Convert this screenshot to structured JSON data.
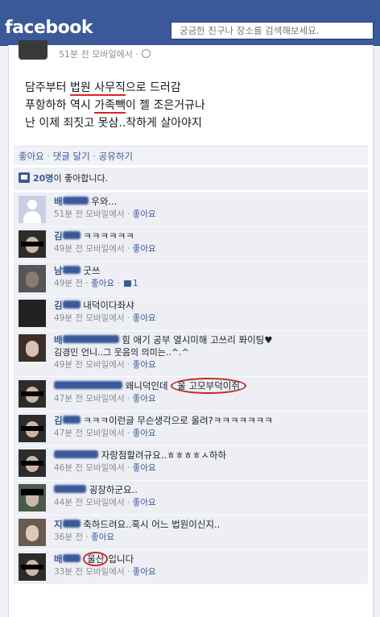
{
  "header": {
    "logo": "facebook",
    "search_placeholder": "궁금한 친구나 장소를 검색해보세요."
  },
  "post": {
    "meta": "51분 전 모바일에서 ·",
    "lines": [
      "담주부터 법원 사무직으로 드러감",
      "푸항하하 역시 가족빽이 젤 조은거규나",
      "난 이제 죄짓고 못삼..착하게 살아야지"
    ],
    "line1_parts": [
      "담주부터 ",
      "법원 사무직",
      "으로 드러감"
    ],
    "line2_parts": [
      "푸항하하 역시 ",
      "가족빽",
      "이 젤 조은거규나"
    ],
    "actions": {
      "like": "좋아요",
      "comment": "댓글 달기",
      "share": "공유하기",
      "sep": " · "
    },
    "likes_count": "20명",
    "likes_suffix": "이 좋아합니다."
  },
  "comments": [
    {
      "name": "배",
      "text": "우와...",
      "meta": "51분 전 모바일에서 · ",
      "like": "좋아요"
    },
    {
      "name": "김",
      "text": "ㅋㅋㅋㅋㅋㅋ",
      "meta": "49분 전 모바일에서 · ",
      "like": "좋아요"
    },
    {
      "name": "남",
      "text": "굿쓰",
      "meta": "49분 전 · ",
      "like": "좋아요",
      "like_count": "1"
    },
    {
      "name": "김",
      "text": "내덕이다좌샤",
      "meta": "49분 전 모바일에서 · ",
      "like": "좋아요"
    },
    {
      "name": "배",
      "text": "힘 애기 공부 열시미해 고쓰리 퐈이팅♥",
      "text2": "김경민 언니..그 웃음의 의미는..^.^",
      "meta": "49분 전 모바일에서 · ",
      "like": "좋아요"
    },
    {
      "name": "",
      "text": "왜니덕인데",
      "text_circled": "울 고모부덕이쥐",
      "meta": "47분 전 모바일에서 · ",
      "like": "좋아요"
    },
    {
      "name": "김",
      "text": "ㅋㅋㅋ이런글 무슨생각으로 올려?ㅋㅋㅋㅋㅋㅋㅋ",
      "meta": "47분 전 모바일에서 · ",
      "like": "좋아요"
    },
    {
      "name": "",
      "text": "자랑점할려규요..ㅎㅎㅎㅎㅅ하하",
      "meta": "46분 전 모바일에서 · ",
      "like": "좋아요"
    },
    {
      "name": "",
      "text": "굉장하군요..",
      "meta": "44분 전 모바일에서 · ",
      "like": "좋아요"
    },
    {
      "name": "지",
      "text": "축하드려요..혹시 어느 법원이신지..",
      "meta": "36분 전 · ",
      "like": "좋아요"
    },
    {
      "name": "배",
      "text_circled": "울산",
      "text": "입니다",
      "meta": "33분 전 모바일에서 · ",
      "like": "좋아요"
    }
  ]
}
